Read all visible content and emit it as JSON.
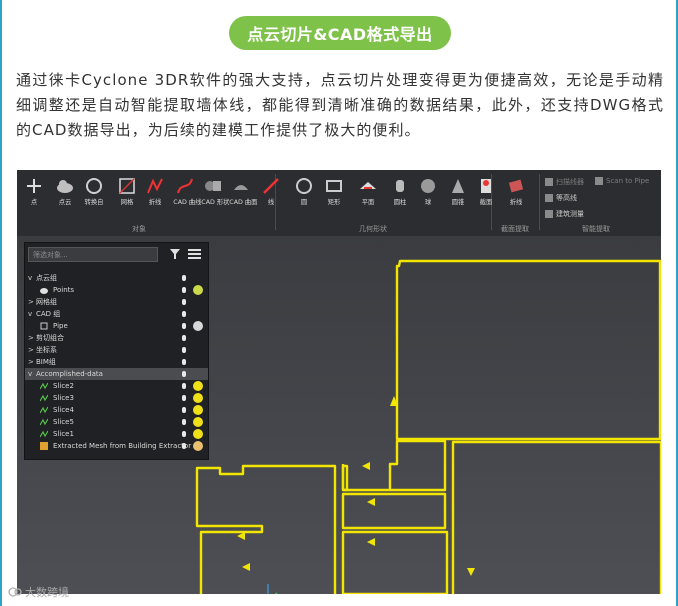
{
  "header": {
    "title": "点云切片&CAD格式导出"
  },
  "paragraph": "通过徕卡Cyclone 3DR软件的强大支持，点云切片处理变得更为便捷高效，无论是手动精细调整还是自动智能提取墙体线，都能得到清晰准确的数据结果，此外，还支持DWG格式的CAD数据导出，为后续的建模工作提供了极大的便利。",
  "ribbon": {
    "tools": [
      {
        "label": "点",
        "icon": "point-icon"
      },
      {
        "label": "点云",
        "icon": "cloud-icon"
      },
      {
        "label": "转换自",
        "icon": "convert-icon"
      },
      {
        "label": "网格",
        "icon": "mesh-icon"
      },
      {
        "label": "折线",
        "icon": "polyline-icon"
      },
      {
        "label": "CAD 曲线",
        "icon": "cad-curve-icon"
      },
      {
        "label": "CAD 形状",
        "icon": "cad-shape-icon"
      },
      {
        "label": "CAD 曲面",
        "icon": "cad-surface-icon"
      },
      {
        "label": "线",
        "icon": "line-icon"
      },
      {
        "label": "圆",
        "icon": "circle-icon"
      },
      {
        "label": "矩形",
        "icon": "rectangle-icon"
      },
      {
        "label": "平面",
        "icon": "plane-icon"
      },
      {
        "label": "圆柱",
        "icon": "cylinder-icon"
      },
      {
        "label": "球",
        "icon": "sphere-icon"
      },
      {
        "label": "圆锥",
        "icon": "cone-icon"
      },
      {
        "label": "截面",
        "icon": "section-icon"
      },
      {
        "label": "折线",
        "icon": "polyline-extract-icon"
      }
    ],
    "groups": [
      "对象",
      "几何形状",
      "截面提取",
      "智能提取"
    ],
    "small_tools": [
      "扫描线器",
      "Scan to Pipe",
      "等高线",
      "建筑测量"
    ]
  },
  "tree": {
    "search_placeholder": "筛选对象...",
    "rows": [
      {
        "label": "点云组",
        "level": 0,
        "expander": "v",
        "bulb": true,
        "dot": ""
      },
      {
        "label": "Points",
        "level": 1,
        "expander": "",
        "bulb": true,
        "dot": "#c9d94a",
        "icon": "cloud-icon"
      },
      {
        "label": "网格组",
        "level": 0,
        "expander": ">",
        "bulb": true,
        "dot": ""
      },
      {
        "label": "CAD 组",
        "level": 0,
        "expander": "v",
        "bulb": true,
        "dot": ""
      },
      {
        "label": "Pipe",
        "level": 1,
        "expander": "",
        "bulb": true,
        "dot": "#d8d8d8",
        "icon": "pipe-icon"
      },
      {
        "label": "剪切组合",
        "level": 0,
        "expander": ">",
        "bulb": true,
        "dot": ""
      },
      {
        "label": "坐标系",
        "level": 0,
        "expander": ">",
        "bulb": true,
        "dot": ""
      },
      {
        "label": "BIM组",
        "level": 0,
        "expander": ">",
        "bulb": true,
        "dot": ""
      },
      {
        "label": "Accomplished-data",
        "level": 0,
        "expander": "v",
        "bulb": true,
        "dot": "",
        "selected": true
      },
      {
        "label": "Slice2",
        "level": 1,
        "expander": "",
        "bulb": true,
        "dot": "#f0e01a",
        "icon": "slice-icon"
      },
      {
        "label": "Slice3",
        "level": 1,
        "expander": "",
        "bulb": true,
        "dot": "#f0e01a",
        "icon": "slice-icon"
      },
      {
        "label": "Slice4",
        "level": 1,
        "expander": "",
        "bulb": true,
        "dot": "#f0e01a",
        "icon": "slice-icon"
      },
      {
        "label": "Slice5",
        "level": 1,
        "expander": "",
        "bulb": true,
        "dot": "#f0e01a",
        "icon": "slice-icon"
      },
      {
        "label": "Slice1",
        "level": 1,
        "expander": "",
        "bulb": true,
        "dot": "#f0e01a",
        "icon": "slice-icon"
      },
      {
        "label": "Extracted Mesh from Building Extractor",
        "level": 1,
        "expander": "",
        "bulb": true,
        "dot": "#e8c070",
        "icon": "mesh-icon"
      }
    ]
  },
  "watermark": "大数跨境",
  "colors": {
    "accent_green": "#7fc24a",
    "slice_yellow": "#f2e600",
    "rail_blue": "#2ea3c7"
  }
}
